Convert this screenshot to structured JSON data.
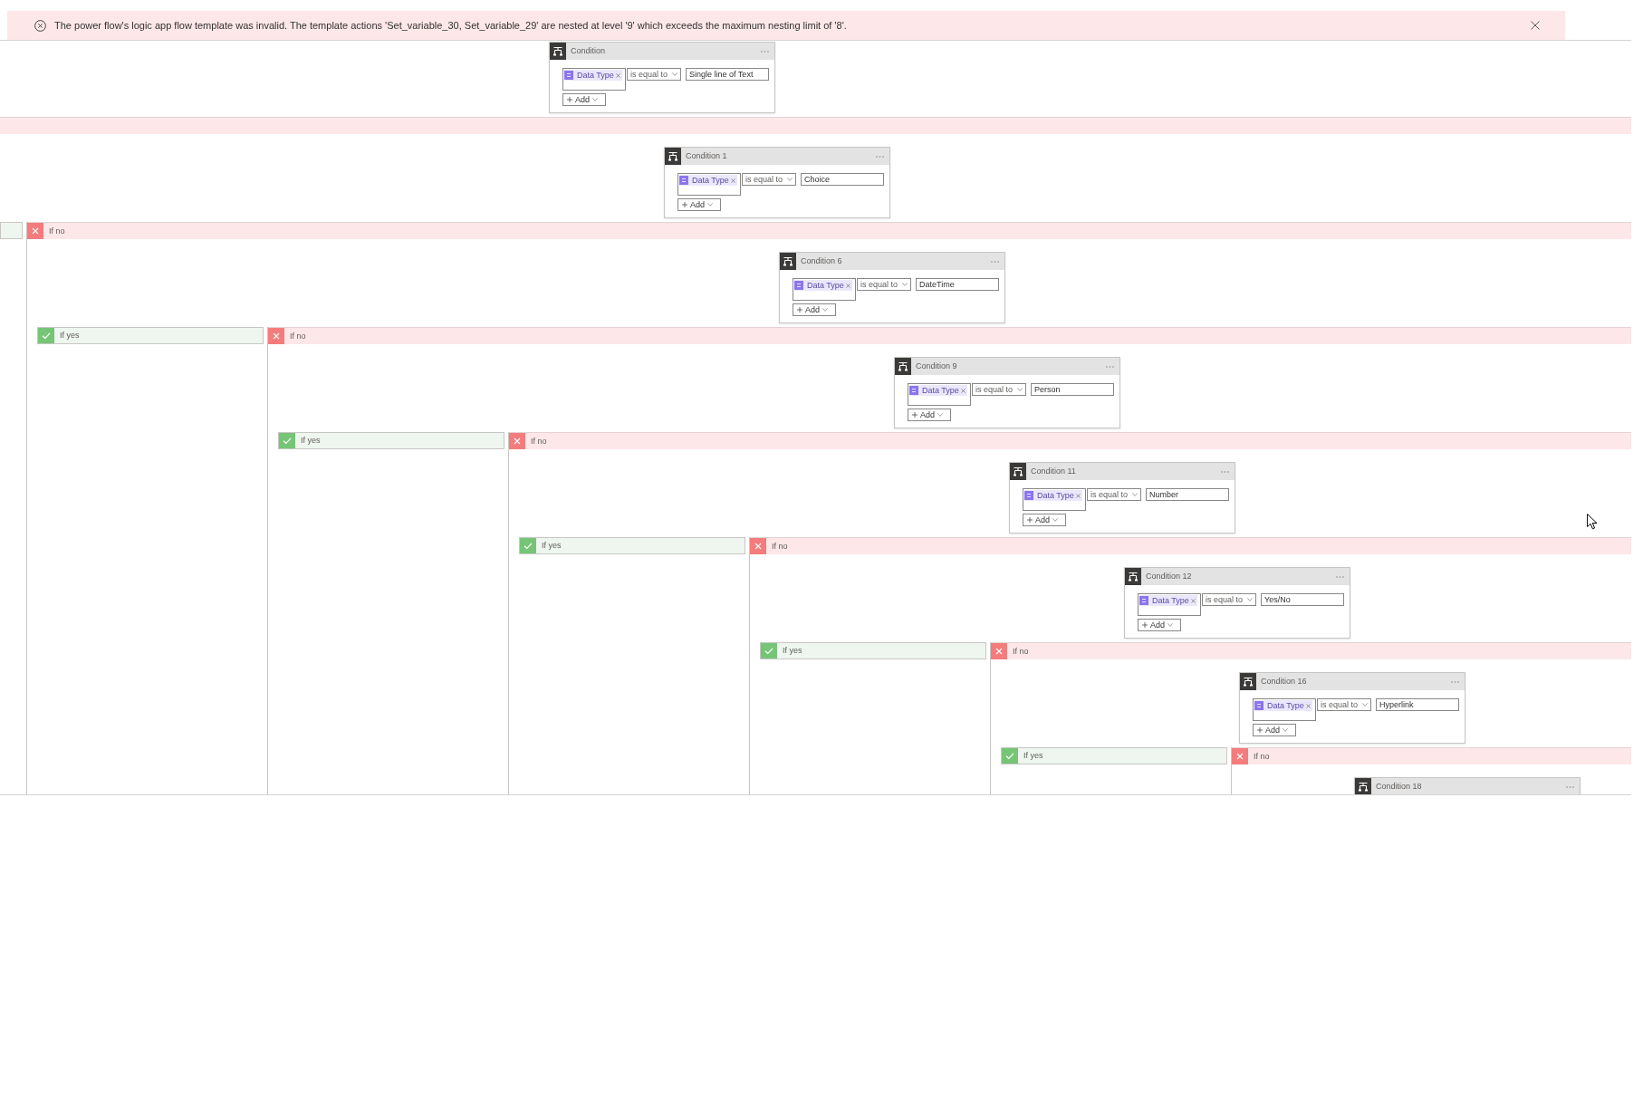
{
  "error_banner": {
    "message": "The power flow's logic app flow template was invalid. The template actions 'Set_variable_30, Set_variable_29' are nested at level '9' which exceeds the maximum nesting limit of '8'."
  },
  "flow": {
    "condition": {
      "title": "Condition",
      "token": "Data Type",
      "operator": "is equal to",
      "value": "Single line of Text",
      "add_button": "Add"
    },
    "children": [
      {
        "kind": "no",
        "condition": {
          "title": "Condition 1",
          "token": "Data Type",
          "operator": "is equal to",
          "value": "Choice",
          "add_button": "Add"
        },
        "children": [
          {
            "kind": "yes"
          },
          {
            "kind": "no",
            "label": "If no",
            "condition": {
              "title": "Condition 6",
              "token": "Data Type",
              "operator": "is equal to",
              "value": "DateTime",
              "add_button": "Add"
            },
            "children": [
              {
                "kind": "yes",
                "label": "If yes"
              },
              {
                "kind": "no",
                "label": "If no",
                "condition": {
                  "title": "Condition 9",
                  "token": "Data Type",
                  "operator": "is equal to",
                  "value": "Person",
                  "add_button": "Add"
                },
                "children": [
                  {
                    "kind": "yes",
                    "label": "If yes"
                  },
                  {
                    "kind": "no",
                    "label": "If no",
                    "condition": {
                      "title": "Condition 11",
                      "token": "Data Type",
                      "operator": "is equal to",
                      "value": "Number",
                      "add_button": "Add"
                    },
                    "children": [
                      {
                        "kind": "yes",
                        "label": "If yes"
                      },
                      {
                        "kind": "no",
                        "label": "If no",
                        "condition": {
                          "title": "Condition 12",
                          "token": "Data Type",
                          "operator": "is equal to",
                          "value": "Yes/No",
                          "add_button": "Add"
                        },
                        "children": [
                          {
                            "kind": "yes",
                            "label": "If yes"
                          },
                          {
                            "kind": "no",
                            "label": "If no",
                            "condition": {
                              "title": "Condition 16",
                              "token": "Data Type",
                              "operator": "is equal to",
                              "value": "Hyperlink",
                              "add_button": "Add"
                            },
                            "children": [
                              {
                                "kind": "yes",
                                "label": "If yes"
                              },
                              {
                                "kind": "no",
                                "label": "If no",
                                "condition": {
                                  "title": "Condition 18"
                                }
                              }
                            ]
                          }
                        ]
                      }
                    ]
                  }
                ]
              }
            ]
          }
        ]
      }
    ]
  }
}
